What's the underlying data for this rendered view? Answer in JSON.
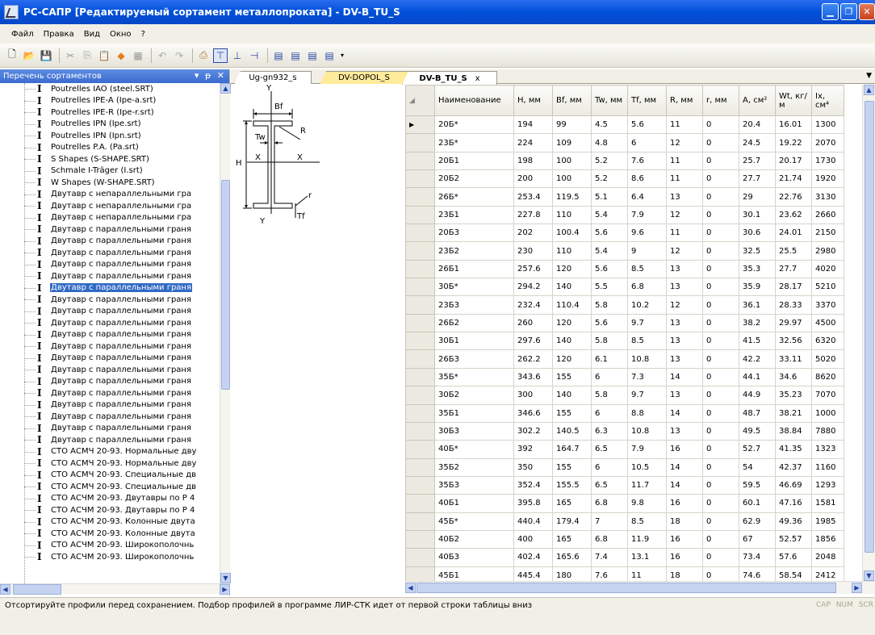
{
  "window": {
    "title": "РС-САПР [Редактируемый сортамент металлопроката] - DV-B_TU_S"
  },
  "menu": [
    "Файл",
    "Правка",
    "Вид",
    "Окно",
    "?"
  ],
  "left_panel": {
    "title": "Перечень сортаментов",
    "items": [
      "Poutrelles IAO (steel.SRT)",
      "Poutrelles IPE-A (Ipe-a.srt)",
      "Poutrelles IPE-R (Ipe-r.srt)",
      "Poutrelles IPN (Ipe.srt)",
      "Poutrelles IPN (Ipn.srt)",
      "Poutrelles P.A. (Pa.srt)",
      "S Shapes (S-SHAPE.SRT)",
      "Schmale I-Träger (I.srt)",
      "W Shapes (W-SHAPE.SRT)",
      "Двутавр с непараллельными гра",
      "Двутавр с непараллельными гра",
      "Двутавр с непараллельными гра",
      "Двутавр с параллельными граня",
      "Двутавр с параллельными граня",
      "Двутавр с параллельными граня",
      "Двутавр с параллельными граня",
      "Двутавр с параллельными граня",
      "Двутавр с параллельными граня",
      "Двутавр с параллельными граня",
      "Двутавр с параллельными граня",
      "Двутавр с параллельными граня",
      "Двутавр с параллельными граня",
      "Двутавр с параллельными граня",
      "Двутавр с параллельными граня",
      "Двутавр с параллельными граня",
      "Двутавр с параллельными граня",
      "Двутавр с параллельными граня",
      "Двутавр с параллельными граня",
      "Двутавр с параллельными граня",
      "Двутавр с параллельными граня",
      "Двутавр с параллельными граня",
      "СТО АСМЧ 20-93. Нормальные дву",
      "СТО АСМЧ 20-93. Нормальные дву",
      "СТО АСМЧ 20-93. Специальные дв",
      "СТО АСМЧ 20-93. Специальные дв",
      "СТО АСЧМ 20-93. Двутавры по Р 4",
      "СТО АСЧМ 20-93. Двутавры по Р 4",
      "СТО АСЧМ 20-93. Колонные двута",
      "СТО АСЧМ 20-93. Колонные двута",
      "СТО АСЧМ 20-93. Широкополочнь",
      "СТО АСЧМ 20-93. Широкополочнь"
    ],
    "selected_index": 17
  },
  "tabs": [
    "Ug-gn932_s",
    "DV-DOPOL_S",
    "DV-B_TU_S"
  ],
  "tab_close": "x",
  "drawing": {
    "labels": {
      "Y": "Y",
      "Bf": "Bf",
      "Tw": "Tw",
      "R": "R",
      "H": "H",
      "X": "X",
      "r": "r",
      "Tf": "Tf"
    }
  },
  "grid": {
    "columns": [
      "Наименование",
      "H, мм",
      "Bf, мм",
      "Tw, мм",
      "Tf, мм",
      "R, мм",
      "r, мм",
      "A, см²",
      "Wt, кг/м",
      "Ix, см⁴"
    ],
    "rows": [
      [
        "20Б*",
        "194",
        "99",
        "4.5",
        "5.6",
        "11",
        "0",
        "20.4",
        "16.01",
        "1300"
      ],
      [
        "23Б*",
        "224",
        "109",
        "4.8",
        "6",
        "12",
        "0",
        "24.5",
        "19.22",
        "2070"
      ],
      [
        "20Б1",
        "198",
        "100",
        "5.2",
        "7.6",
        "11",
        "0",
        "25.7",
        "20.17",
        "1730"
      ],
      [
        "20Б2",
        "200",
        "100",
        "5.2",
        "8.6",
        "11",
        "0",
        "27.7",
        "21.74",
        "1920"
      ],
      [
        "26Б*",
        "253.4",
        "119.5",
        "5.1",
        "6.4",
        "13",
        "0",
        "29",
        "22.76",
        "3130"
      ],
      [
        "23Б1",
        "227.8",
        "110",
        "5.4",
        "7.9",
        "12",
        "0",
        "30.1",
        "23.62",
        "2660"
      ],
      [
        "20Б3",
        "202",
        "100.4",
        "5.6",
        "9.6",
        "11",
        "0",
        "30.6",
        "24.01",
        "2150"
      ],
      [
        "23Б2",
        "230",
        "110",
        "5.4",
        "9",
        "12",
        "0",
        "32.5",
        "25.5",
        "2980"
      ],
      [
        "26Б1",
        "257.6",
        "120",
        "5.6",
        "8.5",
        "13",
        "0",
        "35.3",
        "27.7",
        "4020"
      ],
      [
        "30Б*",
        "294.2",
        "140",
        "5.5",
        "6.8",
        "13",
        "0",
        "35.9",
        "28.17",
        "5210"
      ],
      [
        "23Б3",
        "232.4",
        "110.4",
        "5.8",
        "10.2",
        "12",
        "0",
        "36.1",
        "28.33",
        "3370"
      ],
      [
        "26Б2",
        "260",
        "120",
        "5.6",
        "9.7",
        "13",
        "0",
        "38.2",
        "29.97",
        "4500"
      ],
      [
        "30Б1",
        "297.6",
        "140",
        "5.8",
        "8.5",
        "13",
        "0",
        "41.5",
        "32.56",
        "6320"
      ],
      [
        "26Б3",
        "262.2",
        "120",
        "6.1",
        "10.8",
        "13",
        "0",
        "42.2",
        "33.11",
        "5020"
      ],
      [
        "35Б*",
        "343.6",
        "155",
        "6",
        "7.3",
        "14",
        "0",
        "44.1",
        "34.6",
        "8620"
      ],
      [
        "30Б2",
        "300",
        "140",
        "5.8",
        "9.7",
        "13",
        "0",
        "44.9",
        "35.23",
        "7070"
      ],
      [
        "35Б1",
        "346.6",
        "155",
        "6",
        "8.8",
        "14",
        "0",
        "48.7",
        "38.21",
        "1000"
      ],
      [
        "30Б3",
        "302.2",
        "140.5",
        "6.3",
        "10.8",
        "13",
        "0",
        "49.5",
        "38.84",
        "7880"
      ],
      [
        "40Б*",
        "392",
        "164.7",
        "6.5",
        "7.9",
        "16",
        "0",
        "52.7",
        "41.35",
        "1323"
      ],
      [
        "35Б2",
        "350",
        "155",
        "6",
        "10.5",
        "14",
        "0",
        "54",
        "42.37",
        "1160"
      ],
      [
        "35Б3",
        "352.4",
        "155.5",
        "6.5",
        "11.7",
        "14",
        "0",
        "59.5",
        "46.69",
        "1293"
      ],
      [
        "40Б1",
        "395.8",
        "165",
        "6.8",
        "9.8",
        "16",
        "0",
        "60.1",
        "47.16",
        "1581"
      ],
      [
        "45Б*",
        "440.4",
        "179.4",
        "7",
        "8.5",
        "18",
        "0",
        "62.9",
        "49.36",
        "1985"
      ],
      [
        "40Б2",
        "400",
        "165",
        "6.8",
        "11.9",
        "16",
        "0",
        "67",
        "52.57",
        "1856"
      ],
      [
        "40Б3",
        "402.4",
        "165.6",
        "7.4",
        "13.1",
        "16",
        "0",
        "73.4",
        "57.6",
        "2048"
      ],
      [
        "45Б1",
        "445.4",
        "180",
        "7.6",
        "11",
        "18",
        "0",
        "74.6",
        "58.54",
        "2412"
      ]
    ]
  },
  "status": {
    "text": "Отсортируйте профили перед сохранением. Подбор профилей в программе ЛИР-СТК идет от первой строки таблицы вниз",
    "indicators": [
      "CAP",
      "NUM",
      "SCR"
    ]
  }
}
